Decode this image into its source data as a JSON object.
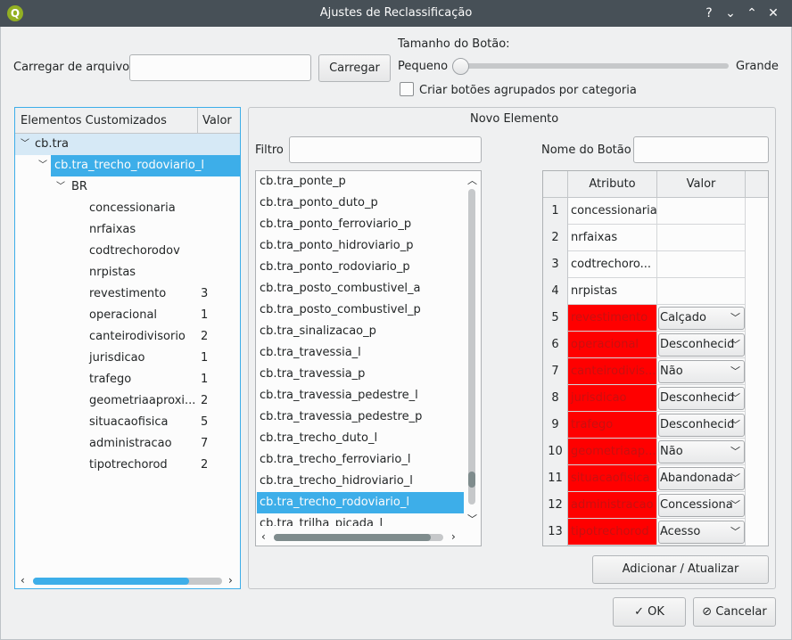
{
  "window": {
    "title": "Ajustes de Reclassificação",
    "title_buttons": [
      "?",
      "⌄",
      "⌃",
      "✕"
    ]
  },
  "top": {
    "load_label": "Carregar de arquivo",
    "load_input_value": "",
    "load_button": "Carregar",
    "size_label": "Tamanho do Botão:",
    "small_label": "Pequeno",
    "large_label": "Grande",
    "slider_value": 0,
    "group_checkbox_label": "Criar botões agrupados por categoria",
    "group_checkbox_checked": false
  },
  "tree": {
    "headers": [
      "Elementos Customizados",
      "Valor"
    ],
    "root": "cb.tra",
    "child": "cb.tra_trecho_rodoviario_l",
    "group": "BR",
    "items": [
      {
        "label": "concessionaria",
        "value": ""
      },
      {
        "label": "nrfaixas",
        "value": ""
      },
      {
        "label": "codtrechorodov",
        "value": ""
      },
      {
        "label": "nrpistas",
        "value": ""
      },
      {
        "label": "revestimento",
        "value": "3"
      },
      {
        "label": "operacional",
        "value": "1"
      },
      {
        "label": "canteirodivisorio",
        "value": "2"
      },
      {
        "label": "jurisdicao",
        "value": "1"
      },
      {
        "label": "trafego",
        "value": "1"
      },
      {
        "label": "geometriaaproxi...",
        "value": "2"
      },
      {
        "label": "situacaofisica",
        "value": "5"
      },
      {
        "label": "administracao",
        "value": "7"
      },
      {
        "label": "tipotrechorod",
        "value": "2"
      }
    ]
  },
  "novo": {
    "title": "Novo Elemento",
    "filter_label": "Filtro",
    "filter_value": "",
    "button_name_label": "Nome do Botão",
    "button_name_value": "",
    "list_items": [
      "cb.tra_ponte_p",
      "cb.tra_ponto_duto_p",
      "cb.tra_ponto_ferroviario_p",
      "cb.tra_ponto_hidroviario_p",
      "cb.tra_ponto_rodoviario_p",
      "cb.tra_posto_combustivel_a",
      "cb.tra_posto_combustivel_p",
      "cb.tra_sinalizacao_p",
      "cb.tra_travessia_l",
      "cb.tra_travessia_p",
      "cb.tra_travessia_pedestre_l",
      "cb.tra_travessia_pedestre_p",
      "cb.tra_trecho_duto_l",
      "cb.tra_trecho_ferroviario_l",
      "cb.tra_trecho_hidroviario_l",
      "cb.tra_trecho_rodoviario_l",
      "cb.tra_trilha_picada_l"
    ],
    "selected_item": "cb.tra_trecho_rodoviario_l",
    "table_headers": [
      "Atributo",
      "Valor"
    ],
    "table_rows": [
      {
        "num": "1",
        "attr": "concessionaria",
        "value": "",
        "highlight": false
      },
      {
        "num": "2",
        "attr": "nrfaixas",
        "value": "",
        "highlight": false
      },
      {
        "num": "3",
        "attr": "codtrechoro...",
        "value": "",
        "highlight": false
      },
      {
        "num": "4",
        "attr": "nrpistas",
        "value": "",
        "highlight": false
      },
      {
        "num": "5",
        "attr": "revestimento",
        "value": "Calçado",
        "highlight": true
      },
      {
        "num": "6",
        "attr": "operacional",
        "value": "Desconhecid",
        "highlight": true
      },
      {
        "num": "7",
        "attr": "canteirodivis...",
        "value": "Não",
        "highlight": true
      },
      {
        "num": "8",
        "attr": "jurisdicao",
        "value": "Desconhecid",
        "highlight": true
      },
      {
        "num": "9",
        "attr": "trafego",
        "value": "Desconhecid",
        "highlight": true
      },
      {
        "num": "10",
        "attr": "geometriaap...",
        "value": "Não",
        "highlight": true
      },
      {
        "num": "11",
        "attr": "situacaofisica",
        "value": "Abandonada",
        "highlight": true
      },
      {
        "num": "12",
        "attr": "administracao",
        "value": "Concessiona",
        "highlight": true
      },
      {
        "num": "13",
        "attr": "tipotrechorod",
        "value": "Acesso",
        "highlight": true
      }
    ],
    "add_button": "Adicionar / Atualizar"
  },
  "footer": {
    "ok_label": "OK",
    "cancel_label": "Cancelar"
  },
  "colors": {
    "accent": "#3daee9",
    "highlight_cell": "#ff0000",
    "titlebar": "#475057"
  }
}
